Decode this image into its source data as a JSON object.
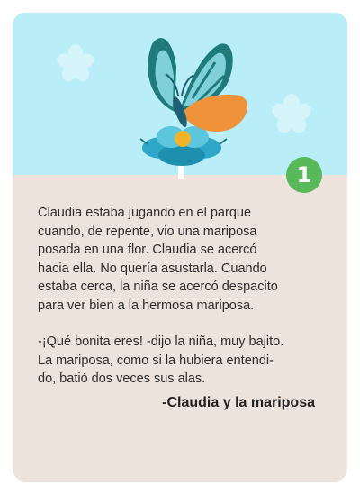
{
  "card": {
    "number": "1",
    "story_lines": [
      "Claudia estaba jugando en el parque",
      "cuando, de repente, vio una mariposa",
      "posada en una flor. Claudia se acercó",
      "hacia ella. No quería asustarla. Cuando",
      "estaba cerca, la niña se acercó despacito",
      "para ver bien a la hermosa mariposa."
    ],
    "dialogue_lines": [
      "-¡Qué bonita eres! -dijo la niña, muy bajito.",
      "La mariposa, como si la hubiera entendi-",
      "do, batió dos veces sus alas."
    ],
    "signature": "-Claudia y la mariposa"
  },
  "colors": {
    "sky": "#b9eef8",
    "card_bottom": "#ede3dd",
    "badge": "#58b85a",
    "wing_teal_dark": "#1f7a7a",
    "wing_teal_light": "#7fd0d9",
    "wing_orange": "#f0923a",
    "flower": "#2fa8c8"
  },
  "icons": [
    "butterfly-illustration",
    "flower-illustration",
    "cloud-flower-icon"
  ]
}
